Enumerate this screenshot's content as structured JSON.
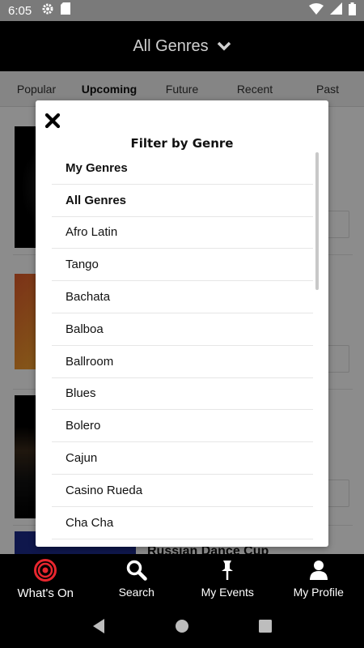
{
  "status_bar": {
    "time": "6:05",
    "left_icons": [
      "gear-icon",
      "sd-card-icon"
    ],
    "right_icons": [
      "wifi-icon",
      "signal-icon",
      "battery-icon"
    ]
  },
  "header": {
    "title": "All Genres",
    "dropdown_icon": "chevron-down-icon"
  },
  "tabs": [
    {
      "label": "Popular",
      "active": false
    },
    {
      "label": "Upcoming",
      "active": true
    },
    {
      "label": "Future",
      "active": false
    },
    {
      "label": "Recent",
      "active": false
    },
    {
      "label": "Past",
      "active": false
    }
  ],
  "background_list": {
    "partial_event_title": "Russian Dance Cup"
  },
  "modal": {
    "close_icon": "close-icon",
    "title": "Filter by Genre",
    "genres": [
      {
        "label": "My Genres",
        "bold": true
      },
      {
        "label": "All Genres",
        "bold": true
      },
      {
        "label": "Afro Latin",
        "bold": false
      },
      {
        "label": "Tango",
        "bold": false
      },
      {
        "label": "Bachata",
        "bold": false
      },
      {
        "label": "Balboa",
        "bold": false
      },
      {
        "label": "Ballroom",
        "bold": false
      },
      {
        "label": "Blues",
        "bold": false
      },
      {
        "label": "Bolero",
        "bold": false
      },
      {
        "label": "Cajun",
        "bold": false
      },
      {
        "label": "Casino Rueda",
        "bold": false
      },
      {
        "label": "Cha Cha",
        "bold": false
      }
    ]
  },
  "bottom_nav": {
    "items": [
      {
        "label": "What's On",
        "icon": "target-icon",
        "active": true
      },
      {
        "label": "Search",
        "icon": "search-icon",
        "active": false
      },
      {
        "label": "My Events",
        "icon": "pin-icon",
        "active": false
      },
      {
        "label": "My Profile",
        "icon": "person-icon",
        "active": false
      }
    ]
  },
  "system_nav": {
    "buttons": [
      "back-icon",
      "home-icon",
      "recents-icon"
    ]
  },
  "colors": {
    "status_bar": "#7a7a7a",
    "header_bg": "#000000",
    "accent_red": "#e8262e",
    "tabs_bg": "#f2f2f2"
  }
}
